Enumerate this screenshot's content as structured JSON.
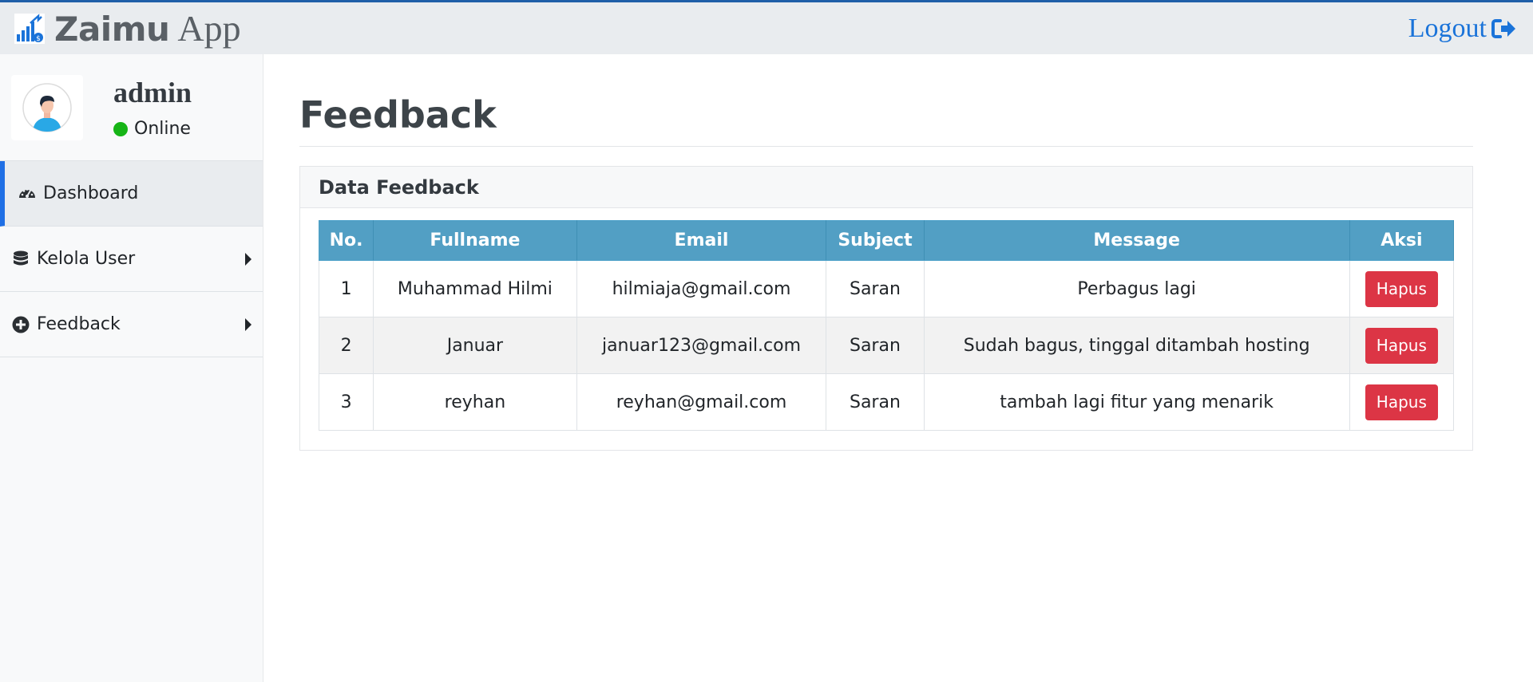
{
  "app": {
    "brand_strong": "Zaimu",
    "brand_light": "App",
    "logout_label": "Logout",
    "logo_icon": "chart-bar-icon",
    "accent_color": "#1a73d9"
  },
  "user": {
    "name": "admin",
    "status": "Online",
    "status_color": "#16b416"
  },
  "sidebar": {
    "items": [
      {
        "label": "Dashboard",
        "icon": "tachometer-icon",
        "active": true
      },
      {
        "label": "Kelola User",
        "icon": "database-icon",
        "active": false
      },
      {
        "label": "Feedback",
        "icon": "plus-circle-icon",
        "active": false
      }
    ]
  },
  "main": {
    "title": "Feedback",
    "card_title": "Data Feedback",
    "table": {
      "headers": [
        "No.",
        "Fullname",
        "Email",
        "Subject",
        "Message",
        "Aksi"
      ],
      "rows": [
        {
          "no": "1",
          "fullname": "Muhammad Hilmi",
          "email": "hilmiaja@gmail.com",
          "subject": "Saran",
          "message": "Perbagus lagi",
          "action": "Hapus"
        },
        {
          "no": "2",
          "fullname": "Januar",
          "email": "januar123@gmail.com",
          "subject": "Saran",
          "message": "Sudah bagus, tinggal ditambah hosting",
          "action": "Hapus"
        },
        {
          "no": "3",
          "fullname": "reyhan",
          "email": "reyhan@gmail.com",
          "subject": "Saran",
          "message": "tambah lagi fitur yang menarik",
          "action": "Hapus"
        }
      ]
    }
  }
}
